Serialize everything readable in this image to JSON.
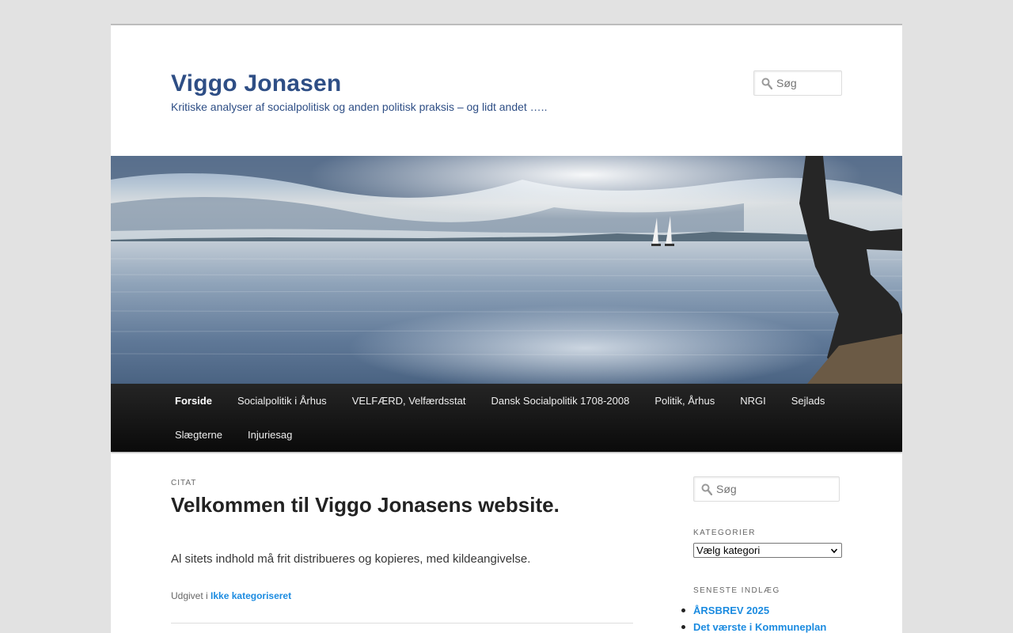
{
  "site": {
    "title": "Viggo Jonasen",
    "description": "Kritiske analyser af socialpolitisk og anden politisk praksis – og lidt andet ….."
  },
  "header_search": {
    "placeholder": "Søg"
  },
  "nav": {
    "row1": [
      {
        "label": "Forside",
        "current": true
      },
      {
        "label": "Socialpolitik i Århus"
      },
      {
        "label": "VELFÆRD, Velfærdsstat"
      },
      {
        "label": "Dansk Socialpolitik 1708-2008"
      },
      {
        "label": "Politik, Århus"
      },
      {
        "label": "NRGI"
      },
      {
        "label": "Sejlads"
      }
    ],
    "row2": [
      {
        "label": "Slægterne"
      },
      {
        "label": "Injuriesag"
      }
    ]
  },
  "post": {
    "format": "Citat",
    "title": "Velkommen til Viggo Jonasens website.",
    "body": "Al sitets indhold må frit distribueres og kopieres, med kildeangivelse.",
    "meta_prefix": "Udgivet i",
    "category": "Ikke kategoriseret"
  },
  "sidebar": {
    "search_placeholder": "Søg",
    "categories_title": "Kategorier",
    "categories_select": "Vælg kategori",
    "recent_title": "Seneste indlæg",
    "recent_posts": [
      "ÅRSBREV 2025",
      "Det værste i Kommuneplan"
    ]
  },
  "colors": {
    "title_blue": "#2e4e85",
    "link_blue": "#1b8be0",
    "nav_bg": "#111111",
    "page_bg": "#e2e2e2"
  }
}
